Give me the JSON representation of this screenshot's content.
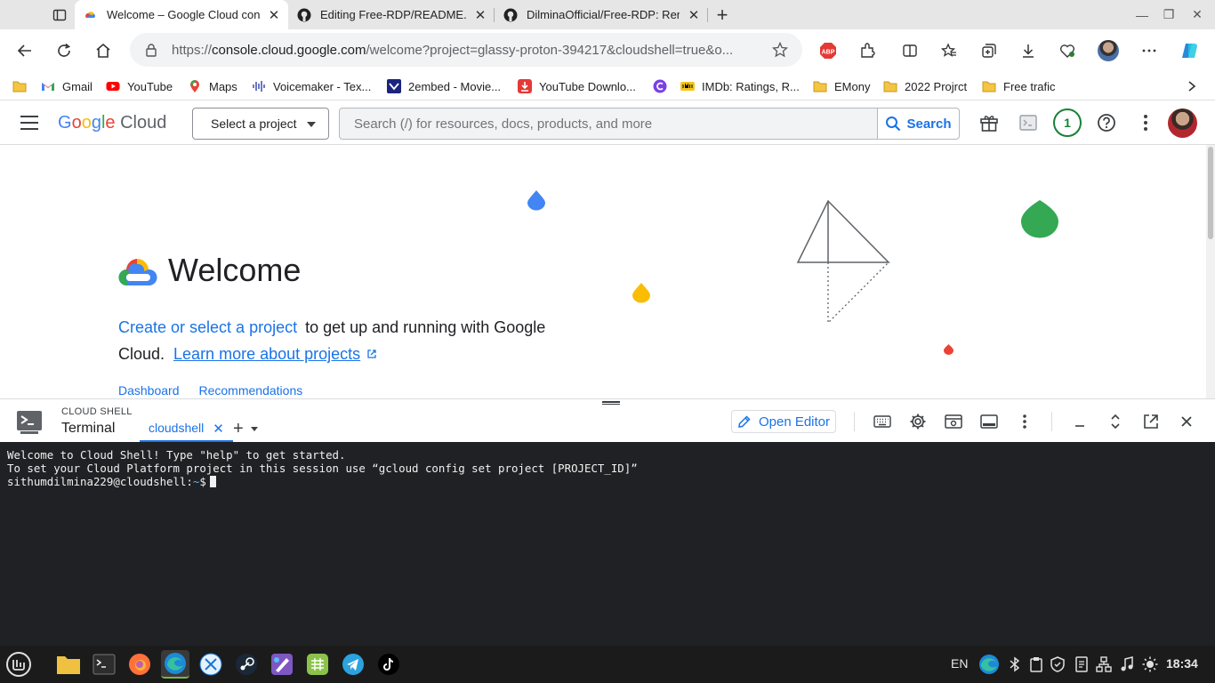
{
  "browser": {
    "tabs": [
      {
        "label": "Welcome – Google Cloud con",
        "icon": "google-cloud-icon",
        "active": true
      },
      {
        "label": "Editing Free-RDP/README.md",
        "icon": "github-icon",
        "active": false
      },
      {
        "label": "DilminaOfficial/Free-RDP: Rem",
        "icon": "github-icon",
        "active": false
      }
    ],
    "url_scheme": "https://",
    "url_host": "console.cloud.google.com",
    "url_path": "/welcome?project=glassy-proton-394217&cloudshell=true&o...",
    "bookmarks": [
      {
        "label": "Gmail",
        "icon": "gmail-icon"
      },
      {
        "label": "YouTube",
        "icon": "youtube-icon"
      },
      {
        "label": "Maps",
        "icon": "maps-icon"
      },
      {
        "label": "Voicemaker - Tex...",
        "icon": "voicemaker-icon"
      },
      {
        "label": "2embed - Movie...",
        "icon": "2embed-icon"
      },
      {
        "label": "YouTube Downlo...",
        "icon": "download-icon"
      },
      {
        "label": "",
        "icon": "c-icon"
      },
      {
        "label": "IMDb: Ratings, R...",
        "icon": "imdb-icon"
      },
      {
        "label": "EMony",
        "icon": "folder-icon"
      },
      {
        "label": "2022 Projrct",
        "icon": "folder-icon"
      },
      {
        "label": "Free trafic",
        "icon": "folder-icon"
      }
    ]
  },
  "gc_header": {
    "logo_google": [
      "G",
      "o",
      "o",
      "g",
      "l",
      "e"
    ],
    "logo_cloud": "Cloud",
    "project_select": "Select a project",
    "search_placeholder": "Search (/) for resources, docs, products, and more",
    "search_button": "Search",
    "notification_count": "1"
  },
  "welcome": {
    "title": "Welcome",
    "create_link": "Create or select a project",
    "text_1": " to get up and running with Google Cloud.",
    "learn_link": "Learn more about projects",
    "tabs": [
      "Dashboard",
      "Recommendations"
    ]
  },
  "cloud_shell": {
    "small_label": "CLOUD SHELL",
    "title": "Terminal",
    "tab": "cloudshell",
    "open_editor": "Open Editor"
  },
  "terminal": {
    "line1": "Welcome to Cloud Shell! Type \"help\" to get started.",
    "line2": "To set your Cloud Platform project in this session use “gcloud config set project [PROJECT_ID]”",
    "prompt_user": "sithumdilmina229@cloudshell:",
    "prompt_path": "~",
    "prompt_symbol": "$"
  },
  "taskbar": {
    "lang": "EN",
    "time": "18:34"
  },
  "colors": {
    "accent": "#1a73e8",
    "terminal_bg": "#202124",
    "taskbar_bg": "#1b1b1b"
  }
}
